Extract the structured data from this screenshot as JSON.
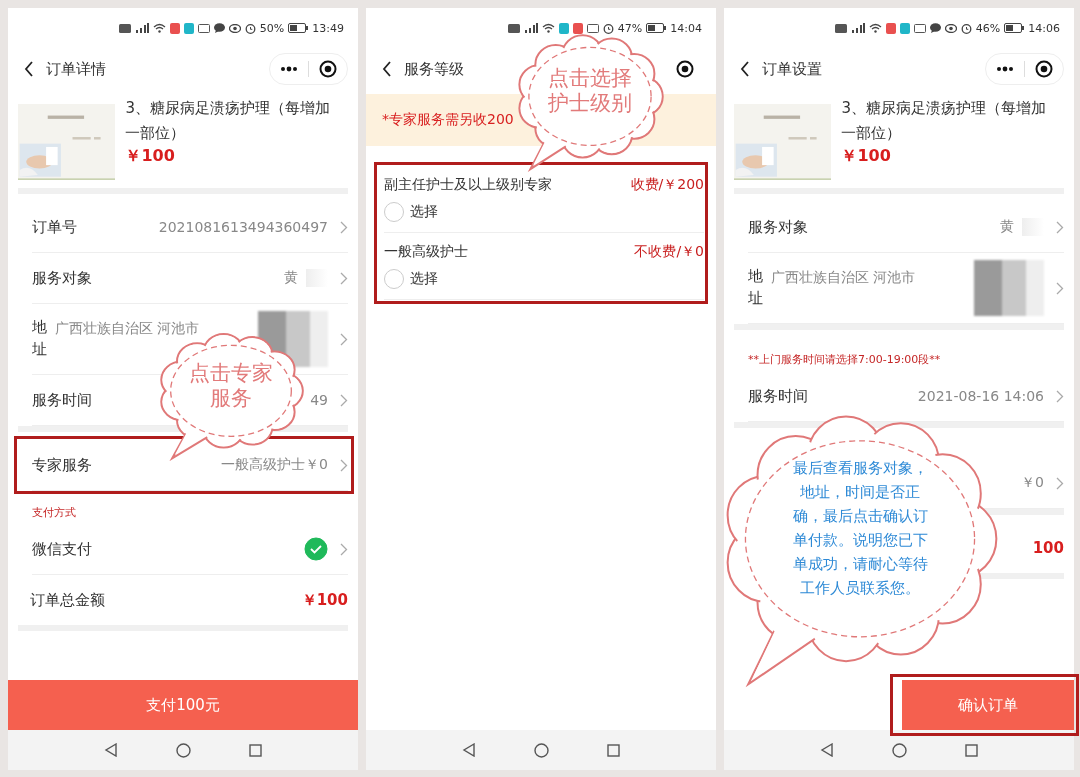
{
  "panels": [
    {
      "status_bar": {
        "battery": "50%",
        "time": "13:49"
      },
      "header": {
        "title": "订单详情",
        "capsule": true
      },
      "sections": [
        {
          "kind": "product",
          "title": "3、糖尿病足溃疡护理（每增加一部位）",
          "price": "￥100"
        },
        {
          "kind": "row",
          "label": "订单号",
          "value": "2021081613494360497"
        },
        {
          "kind": "row",
          "label": "服务对象",
          "value": "黄",
          "redacted": true
        },
        {
          "kind": "address",
          "label": "地址",
          "value": "广西壮族自治区 河池市",
          "redacted": true
        },
        {
          "kind": "row",
          "label": "服务时间",
          "value": "49"
        },
        {
          "kind": "gap"
        },
        {
          "kind": "row",
          "label": "专家服务",
          "value": "一般高级护士￥0",
          "highlighted": true
        },
        {
          "kind": "caption",
          "text": "支付方式"
        },
        {
          "kind": "payment",
          "label": "微信支付",
          "checked": true
        },
        {
          "kind": "total",
          "label": "订单总金额",
          "value": "￥100"
        }
      ],
      "button": {
        "label": "支付100元"
      },
      "callout": {
        "kind": "small",
        "text": "点击专家服务"
      }
    },
    {
      "status_bar": {
        "battery": "47%",
        "time": "14:04"
      },
      "header": {
        "title": "服务等级",
        "capsule": false
      },
      "sections": [
        {
          "kind": "notice",
          "text": "*专家服务需另收200"
        },
        {
          "kind": "options",
          "highlighted": true,
          "items": [
            {
              "name": "副主任护士及以上级别专家",
              "fee": "收费/￥200",
              "choice": "选择",
              "selected": false
            },
            {
              "name": "一般高级护士",
              "fee": "不收费/￥0",
              "choice": "选择",
              "selected": false
            }
          ]
        }
      ],
      "callout": {
        "kind": "small",
        "text": "点击选择护士级别"
      }
    },
    {
      "status_bar": {
        "battery": "46%",
        "time": "14:06"
      },
      "header": {
        "title": "订单设置",
        "capsule": true
      },
      "sections": [
        {
          "kind": "product",
          "title": "3、糖尿病足溃疡护理（每增加一部位）",
          "price": "￥100"
        },
        {
          "kind": "row",
          "label": "服务对象",
          "value": "黄",
          "redacted": true
        },
        {
          "kind": "address",
          "label": "地址",
          "value": "广西壮族自治区 河池市",
          "redacted": true
        },
        {
          "kind": "gap"
        },
        {
          "kind": "caption",
          "text": "**上门服务时间请选择7:00-19:00段**"
        },
        {
          "kind": "row",
          "label": "服务时间",
          "value": "2021-08-16 14:06"
        },
        {
          "kind": "gap"
        },
        {
          "kind": "blank"
        },
        {
          "kind": "row",
          "value": "￥0"
        },
        {
          "kind": "gap"
        },
        {
          "kind": "total",
          "value": "100"
        }
      ],
      "button": {
        "label": "确认订单",
        "highlighted": true
      },
      "callout": {
        "kind": "large",
        "text": "最后查看服务对象，地址，时间是否正确，最后点击确认订单付款。说明您已下单成功，请耐心等待工作人员联系您。"
      }
    }
  ]
}
